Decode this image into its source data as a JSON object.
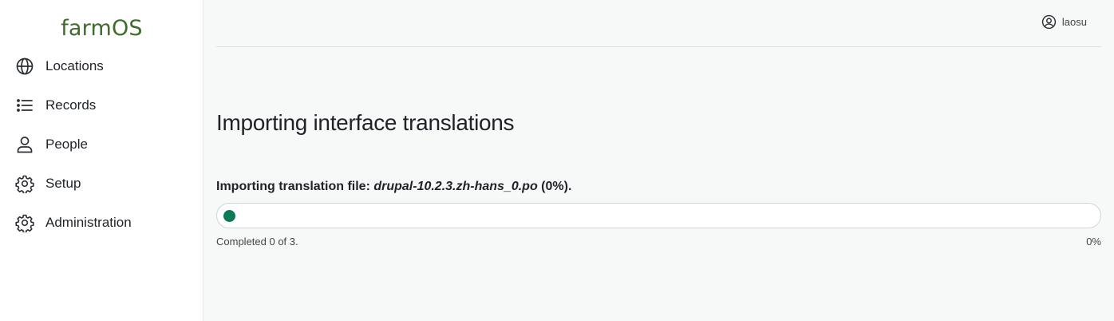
{
  "sidebar": {
    "logo": "farmOS",
    "items": [
      {
        "label": "Locations",
        "icon": "globe-icon"
      },
      {
        "label": "Records",
        "icon": "list-icon"
      },
      {
        "label": "People",
        "icon": "person-icon"
      },
      {
        "label": "Setup",
        "icon": "gear-icon"
      },
      {
        "label": "Administration",
        "icon": "gear-icon"
      }
    ]
  },
  "header": {
    "user": {
      "name": "laosu",
      "icon": "user-circle-icon"
    }
  },
  "main": {
    "title": "Importing interface translations",
    "progress": {
      "message_prefix": "Importing translation file: ",
      "file_name": "drupal-10.2.3.zh-hans_0.po",
      "message_suffix": " (0%).",
      "status": "Completed 0 of 3.",
      "percent_label": "0%",
      "percent_value": 0,
      "bar_color": "#0c7a56"
    }
  },
  "colors": {
    "brand": "#3f6b2d",
    "accent": "#0c7a56",
    "background": "#f6f9f8"
  }
}
